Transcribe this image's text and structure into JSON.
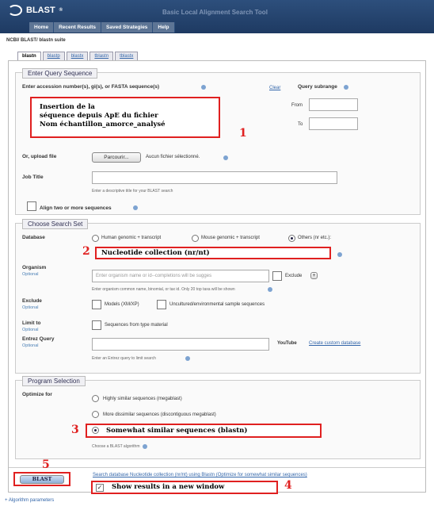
{
  "header": {
    "app_name": "BLAST",
    "registered": "®",
    "subtitle": "Basic Local Alignment Search Tool",
    "nav": [
      "Home",
      "Recent Results",
      "Saved Strategies",
      "Help"
    ]
  },
  "breadcrumb": "NCBI/ BLAST/ blastn suite",
  "tabs": [
    "blastn",
    "blastp",
    "blastx",
    "tblastn",
    "tblastx"
  ],
  "query": {
    "legend": "Enter Query Sequence",
    "label": "Enter accession number(s), gi(s), or FASTA sequence(s)",
    "clear": "Clear",
    "subrange": "Query subrange",
    "from": "From",
    "to": "To",
    "annotation_lines": [
      "Insertion de la",
      "séquence depuis ApE du fichier",
      "Nom échantillon_amorce_analysé"
    ],
    "upload_label": "Or, upload file",
    "browse": "Parcourir...",
    "no_file": "Aucun fichier sélectionné.",
    "job_title": "Job Title",
    "job_hint": "Enter a descriptive title for your BLAST search",
    "align_two": "Align two or more sequences"
  },
  "search_set": {
    "legend": "Choose Search Set",
    "database": "Database",
    "db_options": [
      "Human genomic + transcript",
      "Mouse genomic + transcript",
      "Others (nr etc.):"
    ],
    "db_selected": "Nucleotide collection (nr/nt)",
    "organism": "Organism",
    "optional": "Optional",
    "organism_placeholder": "Enter organism name or id--completions will be sugges",
    "exclude_chk": "Exclude",
    "plus": "+",
    "organism_hint": "Enter organism common name, binomial, or tax id. Only 20 top taxa will be shown",
    "exclude": "Exclude",
    "models": "Models (XM/XP)",
    "uncultured": "Uncultured/environmental sample sequences",
    "limit_to": "Limit to",
    "type_material": "Sequences from type material",
    "entrez": "Entrez Query",
    "youtube": "YouTube",
    "custom_db": "Create custom database",
    "entrez_hint": "Enter an Entrez query to limit search"
  },
  "program": {
    "legend": "Program Selection",
    "optimize": "Optimize for",
    "options": [
      "Highly similar sequences (megablast)",
      "More dissimilar sequences (discontiguous megablast)"
    ],
    "selected": "Somewhat similar sequences (blastn)",
    "hint": "Choose a BLAST algorithm"
  },
  "submit": {
    "button": "BLAST",
    "summary": "Search database Nucleotide collection (nr/nt) using Blastn (Optimize for somewhat similar sequences)",
    "new_window": "Show results in a new window"
  },
  "footer": "+ Algorithm parameters",
  "steps": [
    "1",
    "2",
    "3",
    "4",
    "5"
  ]
}
